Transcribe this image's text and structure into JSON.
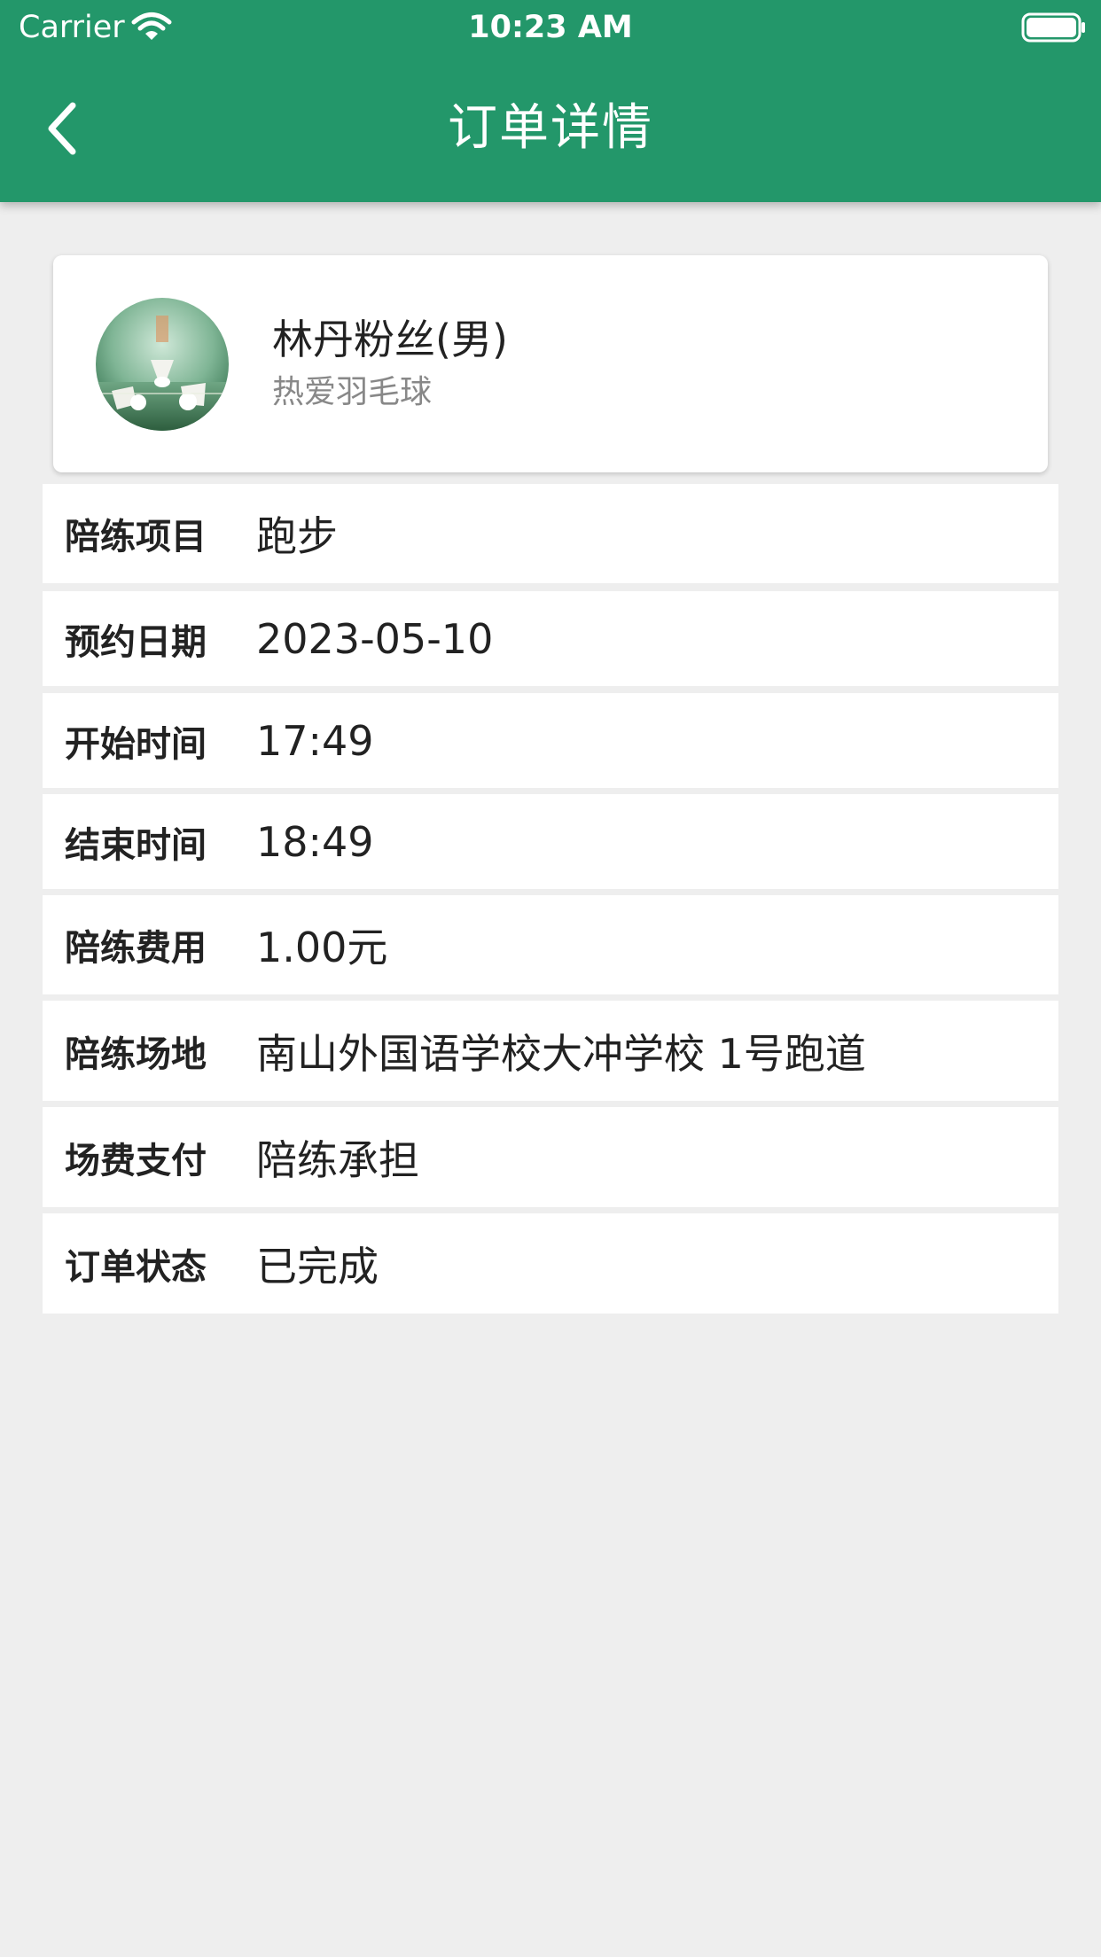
{
  "status_bar": {
    "carrier": "Carrier",
    "time": "10:23 AM"
  },
  "header": {
    "title": "订单详情",
    "background_color": "#23976a"
  },
  "profile": {
    "name": "林丹粉丝(男)",
    "description": "热爱羽毛球"
  },
  "details": [
    {
      "label": "陪练项目",
      "value": "跑步"
    },
    {
      "label": "预约日期",
      "value": "2023-05-10"
    },
    {
      "label": "开始时间",
      "value": "17:49"
    },
    {
      "label": "结束时间",
      "value": "18:49"
    },
    {
      "label": "陪练费用",
      "value": "1.00元"
    },
    {
      "label": "陪练场地",
      "value": "南山外国语学校大冲学校 1号跑道"
    },
    {
      "label": "场费支付",
      "value": "陪练承担"
    },
    {
      "label": "订单状态",
      "value": "已完成"
    }
  ]
}
